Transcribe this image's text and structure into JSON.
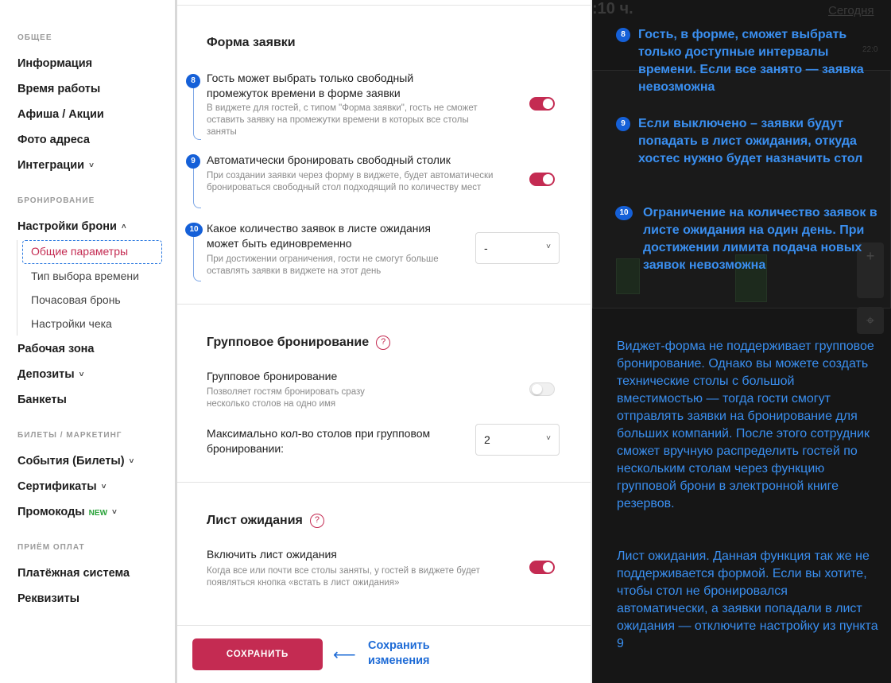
{
  "sidebar": {
    "sections": [
      {
        "title": "ОБЩЕЕ",
        "items": [
          {
            "label": "Информация"
          },
          {
            "label": "Время работы"
          },
          {
            "label": "Афиша / Акции"
          },
          {
            "label": "Фото адреса"
          },
          {
            "label": "Интеграции",
            "chevron": "˅"
          }
        ]
      },
      {
        "title": "БРОНИРОВАНИЕ"
      }
    ],
    "booking_settings": {
      "label": "Настройки брони",
      "chevron": "˄"
    },
    "booking_sub": [
      "Общие параметры",
      "Тип выбора времени",
      "Почасовая бронь",
      "Настройки чека"
    ],
    "booking_rest": [
      {
        "label": "Рабочая зона"
      },
      {
        "label": "Депозиты",
        "chevron": "˅"
      },
      {
        "label": "Банкеты"
      }
    ],
    "tickets_title": "БИЛЕТЫ / МАРКЕТИНГ",
    "tickets": [
      {
        "label": "События (Билеты)",
        "chevron": "˅"
      },
      {
        "label": "Сертификаты",
        "chevron": "˅"
      },
      {
        "label": "Промокоды",
        "badge": "NEW",
        "chevron": "˅"
      }
    ],
    "payments_title": "ПРИЁМ ОПЛАТ",
    "payments": [
      {
        "label": "Платёжная система"
      },
      {
        "label": "Реквизиты"
      }
    ]
  },
  "main": {
    "form_section": {
      "title": "Форма заявки",
      "opt1": {
        "num": "8",
        "label": "Гость может выбрать только свободный промежуток времени в форме заявки",
        "desc": "В виджете для гостей, с типом \"Форма заявки\", гость не сможет оставить заявку на промежутки времени в которых все столы заняты",
        "enabled": true
      },
      "opt2": {
        "num": "9",
        "label": "Автоматически бронировать свободный столик",
        "desc": "При создании заявки через форму в виджете, будет автоматически бронироваться свободный стол подходящий по количеству мест",
        "enabled": true
      },
      "opt3": {
        "num": "10",
        "label": "Какое количество заявок в листе ожидания может быть единовременно",
        "desc": "При достижении ограничения, гости не смогут больше оставлять заявки в виджете на этот день",
        "value": "-"
      }
    },
    "group_section": {
      "title": "Групповое бронирование",
      "help": "?",
      "opt1": {
        "label": "Групповое бронирование",
        "desc": "Позволяет гостям бронировать сразу несколько столов на одно имя",
        "enabled": false
      },
      "opt2": {
        "label": "Максимально кол-во столов при групповом бронировании:",
        "value": "2"
      }
    },
    "waitlist_section": {
      "title": "Лист ожидания",
      "help": "?",
      "opt1": {
        "label": "Включить лист ожидания",
        "desc": "Когда все или почти все столы заняты, у гостей в виджете будет появляться кнопка «встать в лист ожидания»",
        "enabled": true
      }
    },
    "save_button": "СОХРАНИТЬ",
    "save_arrow": "⟵",
    "save_hint": "Сохранить изменения"
  },
  "right_panel": {
    "ghost": {
      "time": ":10 ч.",
      "today": "Сегодня",
      "hour": "22:0"
    },
    "annotations": [
      {
        "num": "8",
        "text": "Гость, в форме, сможет выбрать только доступные интервалы времени. Если все занято — заявка невозможна"
      },
      {
        "num": "9",
        "text": "Если выключено – заявки будут попадать в лист ожидания, откуда хостес нужно будет назначить стол"
      },
      {
        "num": "10",
        "text": "Ограничение на количество заявок в листе ожидания на один день. При достижении лимита подача новых заявок невозможна"
      }
    ],
    "note_group": "Виджет-форма не поддерживает групповое бронирование. Однако вы можете создать технические столы с большой вместимостью — тогда гости смогут отправлять заявки на бронирование для больших компаний. После этого сотрудник сможет вручную распределить гостей по нескольким столам через функцию групповой брони в электронной книге резервов.",
    "note_waitlist": "Лист ожидания. Данная функция так же не поддерживается формой. Если вы хотите, чтобы стол не бронировался автоматически, а заявки попадали в лист ожидания — отключите настройку из пункта 9",
    "map_zoom_in": "+",
    "map_zoom_out": "−",
    "map_locate": "⌖"
  },
  "colors": {
    "accent": "#c42b52",
    "annotation_blue": "#3a8ff0",
    "badge_blue": "#1560d8",
    "dark_bg": "#161616"
  }
}
